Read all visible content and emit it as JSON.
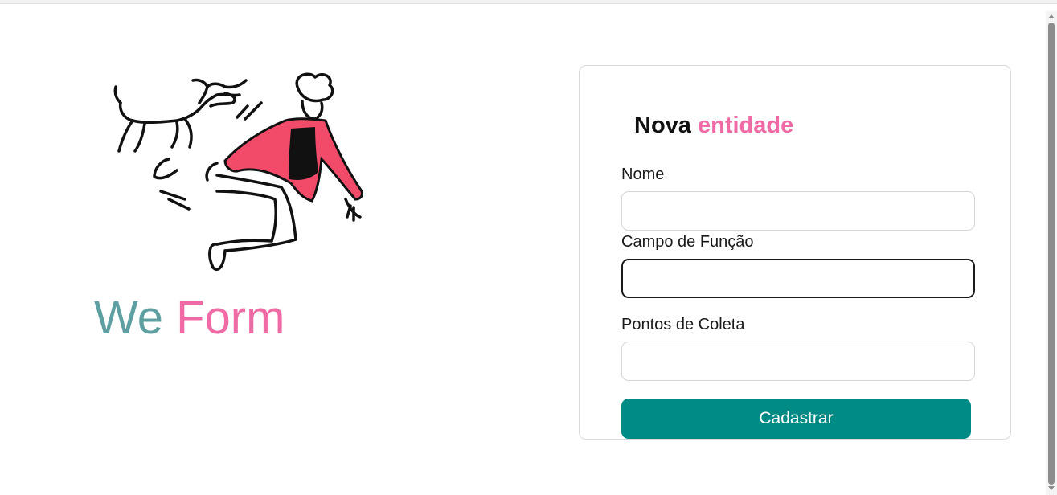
{
  "brand": {
    "word1": "We",
    "word2": "Form",
    "colors": {
      "word1": "#5e9fa1",
      "word2": "#f06aa5"
    }
  },
  "illustration": {
    "icon": "person-jumping-with-dog-illustration"
  },
  "form": {
    "title_part1": "Nova",
    "title_part2": "entidade",
    "fields": [
      {
        "label": "Nome",
        "value": "",
        "placeholder": ""
      },
      {
        "label": "Campo de Função",
        "value": "",
        "placeholder": ""
      },
      {
        "label": "Pontos de Coleta",
        "value": "",
        "placeholder": ""
      }
    ],
    "submit_label": "Cadastrar",
    "colors": {
      "accent": "#008a86",
      "title_highlight": "#f06aa5"
    }
  }
}
